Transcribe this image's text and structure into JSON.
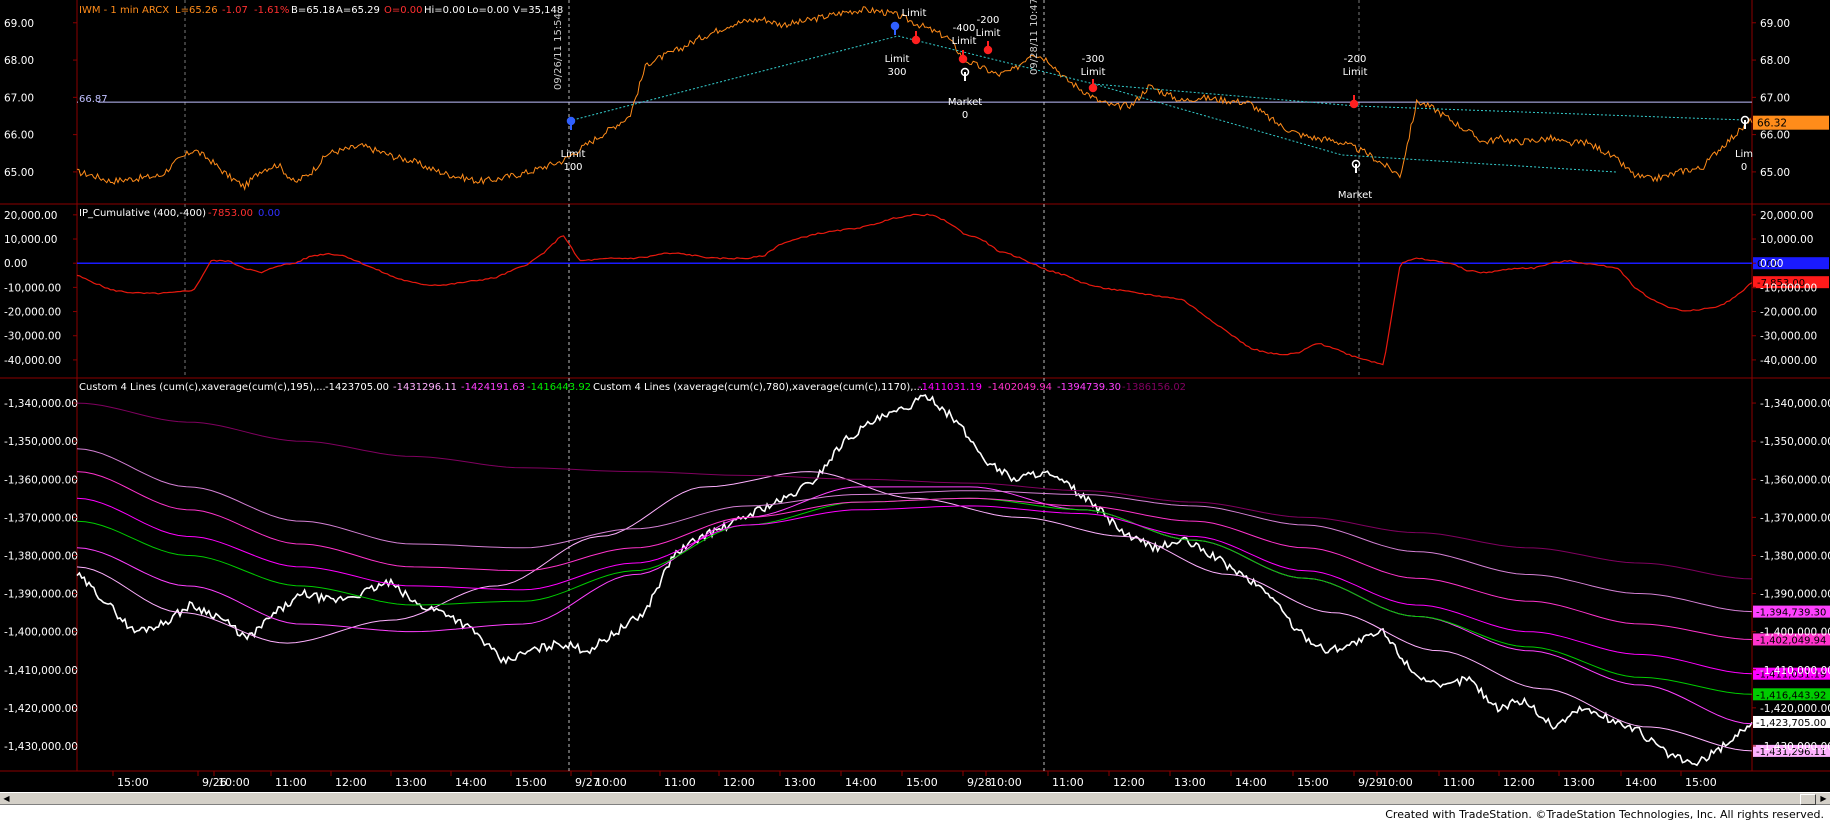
{
  "symbol_header": {
    "symbol": "IWM - 1 min ARCX",
    "last": "L=65.26",
    "change": "-1.07",
    "change_pct": "-1.61%",
    "bid": "B=65.18",
    "ask": "A=65.29",
    "open": "O=0.00",
    "high": "Hi=0.00",
    "low": "Lo=0.00",
    "volume": "V=35,148"
  },
  "colors": {
    "background": "#000000",
    "grid": "#8b0000",
    "price_line": "#ff8c1a",
    "cumulative_line": "#e8190e",
    "zero_line": "#1a1aff",
    "dotted_trend": "#33cccc",
    "ref_line": "#c0c0ff",
    "study_main": "#ffffff",
    "study_195": "#ffb0ff",
    "study_390": "#ff40ff",
    "study_585": "#00cc00",
    "study_780": "#ff00ff",
    "study_975": "#ff33cc",
    "study_1170": "#d580d5",
    "study_long": "#800060"
  },
  "chart_data": [
    {
      "type": "line",
      "panel": "price",
      "title": "IWM - 1 min ARCX",
      "ylim": [
        64.3,
        69.45
      ],
      "yticks": [
        "69.00",
        "68.00",
        "67.00",
        "66.00",
        "65.00"
      ],
      "reference_line": {
        "value": 66.87,
        "label": "66.87"
      },
      "last_price_label": "66.32",
      "series": [
        {
          "values": [
            65.0,
            64.9,
            64.75,
            64.8,
            64.85,
            64.9,
            65.3,
            65.6,
            65.3,
            64.9,
            64.6,
            65.05,
            65.2,
            64.7,
            65.0,
            65.5,
            65.6,
            65.7,
            65.55,
            65.4,
            65.3,
            65.1,
            64.95,
            64.85,
            64.75,
            64.8,
            64.9,
            65.0,
            65.15,
            65.3,
            65.6,
            65.9,
            66.2,
            66.5,
            67.9,
            68.1,
            68.3,
            68.55,
            68.75,
            68.95,
            69.05,
            69.1,
            68.95,
            69.0,
            69.1,
            69.2,
            69.3,
            69.35,
            69.3,
            69.2,
            69.0,
            68.8,
            68.6,
            68.0,
            67.8,
            67.6,
            67.75,
            68.2,
            68.0,
            67.5,
            67.2,
            66.9,
            66.75,
            66.8,
            67.3,
            67.1,
            66.9,
            67.0,
            66.95,
            66.9,
            66.85,
            66.5,
            66.2,
            66.0,
            65.9,
            65.85,
            65.7,
            65.5,
            65.2,
            64.9,
            66.9,
            66.7,
            66.4,
            66.1,
            65.8,
            65.9,
            65.8,
            65.85,
            65.9,
            65.75,
            65.8,
            65.6,
            65.3,
            64.9,
            64.8,
            64.9,
            65.05,
            65.1,
            65.6,
            66.0,
            66.4
          ]
        }
      ],
      "annotations": [
        {
          "text": "09/26/11 15:54",
          "kind": "timestamp"
        },
        {
          "text": "09/28/11 10:47",
          "kind": "timestamp"
        },
        {
          "lines": [
            "Limit",
            "100"
          ],
          "kind": "buy"
        },
        {
          "lines": [
            "Limit",
            "300"
          ],
          "kind": "buy"
        },
        {
          "lines": [
            "Limit"
          ],
          "kind": "sell"
        },
        {
          "lines": [
            "-400",
            "Limit"
          ],
          "kind": "sell"
        },
        {
          "lines": [
            "-200",
            "Limit"
          ],
          "kind": "sell"
        },
        {
          "lines": [
            "Market",
            "0"
          ],
          "kind": "exit"
        },
        {
          "lines": [
            "-300",
            "Limit"
          ],
          "kind": "sell"
        },
        {
          "lines": [
            "-200",
            "Limit"
          ],
          "kind": "sell"
        },
        {
          "lines": [
            "Market"
          ],
          "kind": "exit"
        },
        {
          "lines": [
            "Lim",
            "0"
          ],
          "kind": "exit"
        }
      ]
    },
    {
      "type": "line",
      "panel": "cumulative",
      "title": "IP_Cumulative (400,-400)",
      "value_labels": [
        "-7853.00",
        "0.00"
      ],
      "ylim": [
        -45000,
        22000
      ],
      "yticks": [
        "20,000.00",
        "10,000.00",
        "0.00",
        "-10,000.00",
        "-20,000.00",
        "-30,000.00",
        "-40,000.00"
      ],
      "side_labels": [
        "0.00",
        "-7,853.00"
      ],
      "series": [
        {
          "name": "IP_Cumulative",
          "values": [
            -5000,
            -8000,
            -11000,
            -12000,
            -12500,
            -12500,
            -12000,
            -11000,
            1000,
            1000,
            -2000,
            -4000,
            -1000,
            0,
            3000,
            4000,
            3000,
            0,
            -3000,
            -6000,
            -8000,
            -9000,
            -9000,
            -8000,
            -7000,
            -6000,
            -3000,
            0,
            5000,
            12000,
            1000,
            1500,
            2000,
            2000,
            2500,
            4000,
            4000,
            3000,
            2000,
            2000,
            2000,
            3000,
            8000,
            10000,
            12000,
            13000,
            14000,
            15000,
            17000,
            19000,
            20000,
            20000,
            17000,
            12000,
            10000,
            5000,
            3000,
            0,
            -3000,
            -5000,
            -8000,
            -10000,
            -11000,
            -12000,
            -13000,
            -14000,
            -15000,
            -20000,
            -25000,
            -30000,
            -35000,
            -37000,
            -38000,
            -37000,
            -33000,
            -35000,
            -38000,
            -40000,
            -42000,
            0,
            2000,
            1000,
            0,
            -3000,
            -4000,
            -3000,
            -2000,
            -2000,
            0,
            1000,
            0,
            -1000,
            -2000,
            -10000,
            -15000,
            -18000,
            -20000,
            -19000,
            -18000,
            -14000,
            -7853
          ]
        },
        {
          "name": "zero",
          "values": [
            0,
            0
          ]
        }
      ]
    },
    {
      "type": "line",
      "panel": "study",
      "title": "Custom 4 Lines",
      "legend_a": {
        "label": "Custom 4 Lines (cum(c),xaverage(cum(c),195),...",
        "values": [
          "-1423705.00",
          "-1431296.11",
          "-1424191.63",
          "-1416443.92"
        ]
      },
      "legend_b": {
        "label": "Custom 4 Lines (xaverage(cum(c),780),xaverage(cum(c),1170),...",
        "values": [
          "-1411031.19",
          "-1402049.94",
          "-1394739.30",
          "-1386156.02"
        ]
      },
      "ylim": [
        -1435000,
        -1335000
      ],
      "yticks": [
        "-1,340,000.00",
        "-1,350,000.00",
        "-1,360,000.00",
        "-1,370,000.00",
        "-1,380,000.00",
        "-1,390,000.00",
        "-1,400,000.00",
        "-1,410,000.00",
        "-1,420,000.00",
        "-1,430,000.00"
      ],
      "side_labels": [
        {
          "text": "-1,394,739.30",
          "value": -1394739.3,
          "color": "#ff40ff"
        },
        {
          "text": "-1,402,049.94",
          "value": -1402049.94,
          "color": "#ff33cc"
        },
        {
          "text": "-1,411,031.19",
          "value": -1411031.19,
          "color": "#ff00ff"
        },
        {
          "text": "-1,416,443.92",
          "value": -1416443.92,
          "color": "#00cc00"
        },
        {
          "text": "-1,423,705.00",
          "value": -1423705.0,
          "color": "#ffffff"
        },
        {
          "text": "-1,431,296.11",
          "value": -1431296.11,
          "color": "#ffb0ff"
        }
      ],
      "series": [
        {
          "values": [
            -1385000,
            -1392000,
            -1400000,
            -1398000,
            -1393000,
            -1396000,
            -1402000,
            -1395000,
            -1390000,
            -1392000,
            -1390000,
            -1387000,
            -1393000,
            -1395000,
            -1400000,
            -1408000,
            -1405000,
            -1403000,
            -1405000,
            -1400000,
            -1395000,
            -1380000,
            -1375000,
            -1372000,
            -1368000,
            -1365000,
            -1360000,
            -1350000,
            -1345000,
            -1342000,
            -1338000,
            -1345000,
            -1355000,
            -1360000,
            -1358000,
            -1362000,
            -1368000,
            -1375000,
            -1378000,
            -1376000,
            -1380000,
            -1385000,
            -1390000,
            -1400000,
            -1405000,
            -1403000,
            -1400000,
            -1410000,
            -1415000,
            -1412000,
            -1420000,
            -1418000,
            -1425000,
            -1420000,
            -1423000,
            -1426000,
            -1432000,
            -1435000,
            -1430000,
            -1423705
          ]
        },
        {
          "values": [
            -1383000,
            -1395000,
            -1403000,
            -1397000,
            -1388000,
            -1375000,
            -1362000,
            -1358000,
            -1365000,
            -1370000,
            -1375000,
            -1385000,
            -1395000,
            -1405000,
            -1415000,
            -1425000,
            -1431296
          ]
        },
        {
          "values": [
            -1378000,
            -1388000,
            -1398000,
            -1400000,
            -1398000,
            -1385000,
            -1370000,
            -1362000,
            -1362000,
            -1368000,
            -1376000,
            -1386000,
            -1396000,
            -1405000,
            -1414000,
            -1424191
          ]
        },
        {
          "values": [
            -1371000,
            -1380000,
            -1388000,
            -1393000,
            -1392000,
            -1384000,
            -1372000,
            -1366000,
            -1365000,
            -1368000,
            -1376000,
            -1386000,
            -1396000,
            -1404000,
            -1412000,
            -1416443
          ]
        },
        {
          "values": [
            -1365000,
            -1375000,
            -1383000,
            -1388000,
            -1389000,
            -1382000,
            -1372000,
            -1368000,
            -1367000,
            -1369000,
            -1375000,
            -1384000,
            -1393000,
            -1400000,
            -1406000,
            -1411031
          ]
        },
        {
          "values": [
            -1358000,
            -1368000,
            -1377000,
            -1383000,
            -1384000,
            -1378000,
            -1370000,
            -1366000,
            -1365000,
            -1367000,
            -1371000,
            -1378000,
            -1386000,
            -1392000,
            -1398000,
            -1402049
          ]
        },
        {
          "values": [
            -1352000,
            -1362000,
            -1371000,
            -1377000,
            -1378000,
            -1373000,
            -1367000,
            -1364000,
            -1363000,
            -1364000,
            -1367000,
            -1372000,
            -1379000,
            -1385000,
            -1390000,
            -1394739
          ]
        },
        {
          "values": [
            -1340000,
            -1345000,
            -1350000,
            -1354000,
            -1357000,
            -1358000,
            -1359000,
            -1360000,
            -1361000,
            -1363000,
            -1366000,
            -1370000,
            -1374000,
            -1378000,
            -1382000,
            -1386156
          ]
        }
      ]
    }
  ],
  "x_axis": {
    "ticks": [
      "15:00",
      "9/26",
      "10:00",
      "11:00",
      "12:00",
      "13:00",
      "14:00",
      "15:00",
      "9/27",
      "10:00",
      "11:00",
      "12:00",
      "13:00",
      "14:00",
      "15:00",
      "9/28",
      "10:00",
      "11:00",
      "12:00",
      "13:00",
      "14:00",
      "15:00",
      "9/29",
      "10:00",
      "11:00",
      "12:00",
      "13:00",
      "14:00",
      "15:00"
    ]
  },
  "footer": {
    "credit": "Created with TradeStation. ©TradeStation Technologies, Inc. All rights reserved."
  }
}
